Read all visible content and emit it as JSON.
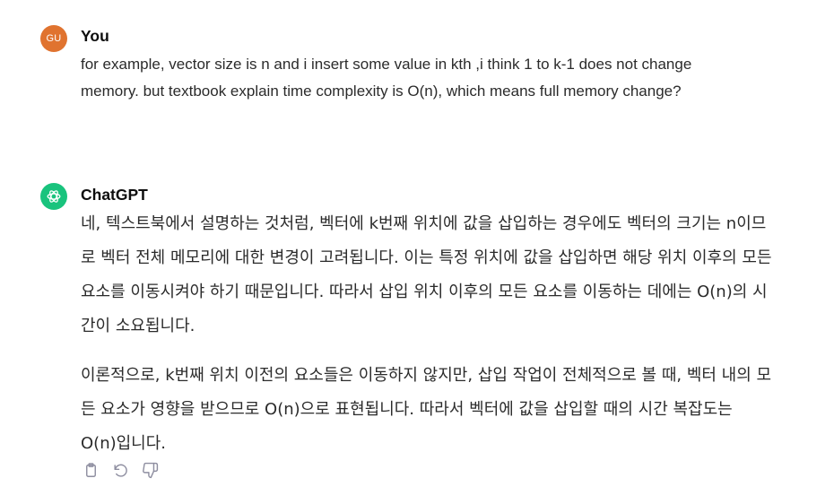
{
  "user_turn": {
    "avatar_initials": "GU",
    "author": "You",
    "message": "for example, vector size is n and i insert some value in kth ,i think 1 to k-1 does not change memory. but textbook explain time complexity is O(n), which means full memory change?"
  },
  "assistant_turn": {
    "avatar_icon": "openai-logo-icon",
    "author": "ChatGPT",
    "paragraphs": [
      "네, 텍스트북에서 설명하는 것처럼, 벡터에 k번째 위치에 값을 삽입하는 경우에도 벡터의 크기는 n이므로 벡터 전체 메모리에 대한 변경이 고려됩니다. 이는 특정 위치에 값을 삽입하면 해당 위치 이후의 모든 요소를 이동시켜야 하기 때문입니다. 따라서 삽입 위치 이후의 모든 요소를 이동하는 데에는 O(n)의 시간이 소요됩니다.",
      "이론적으로, k번째 위치 이전의 요소들은 이동하지 않지만, 삽입 작업이 전체적으로 볼 때, 벡터 내의 모든 요소가 영향을 받으므로 O(n)으로 표현됩니다. 따라서 벡터에 값을 삽입할 때의 시간 복잡도는 O(n)입니다."
    ],
    "actions": [
      "copy-icon",
      "regenerate-icon",
      "thumbs-down-icon"
    ]
  },
  "colors": {
    "user_avatar": "#e0732f",
    "assistant_avatar": "#19c37d",
    "text": "#2b2b2b",
    "icon": "#8e8ea0"
  }
}
